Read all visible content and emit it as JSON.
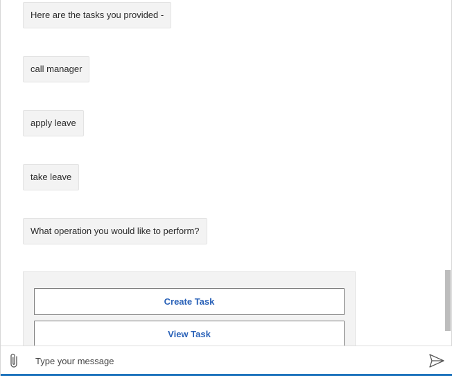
{
  "transcript": {
    "messages": [
      {
        "text": "Here are the tasks you provided -"
      },
      {
        "text": "call manager"
      },
      {
        "text": "apply leave"
      },
      {
        "text": "take leave"
      },
      {
        "text": "What operation you would like to perform?"
      }
    ],
    "card": {
      "buttons": [
        {
          "label": "Create Task"
        },
        {
          "label": "View Task"
        }
      ]
    }
  },
  "composer": {
    "placeholder": "Type your message",
    "value": "",
    "attach_icon": "paperclip-icon",
    "send_icon": "send-icon"
  },
  "colors": {
    "accent": "#1f74bd",
    "button_text": "#2a62b8",
    "bubble_bg": "#f3f3f3"
  }
}
